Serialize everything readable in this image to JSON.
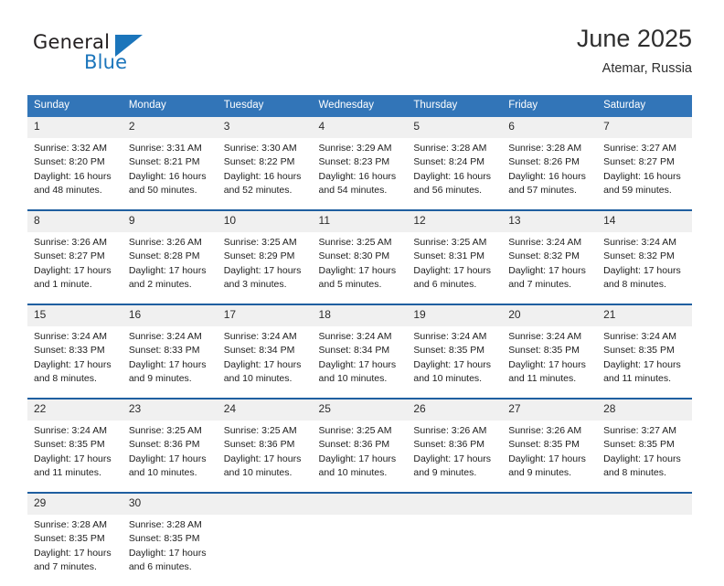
{
  "brand": {
    "name_part1": "General",
    "name_part2": "Blue",
    "flag_icon": "blue-triangle-flag-icon"
  },
  "header": {
    "title": "June 2025",
    "location": "Atemar, Russia"
  },
  "colors": {
    "header_blue": "#3275b8",
    "separator_blue": "#1f5fa0",
    "daynum_band": "#f0f0f0",
    "brand_blue": "#1b75bb"
  },
  "calendar": {
    "weekday_headers": [
      "Sunday",
      "Monday",
      "Tuesday",
      "Wednesday",
      "Thursday",
      "Friday",
      "Saturday"
    ],
    "weeks": [
      {
        "days": [
          {
            "num": "1",
            "sunrise": "Sunrise: 3:32 AM",
            "sunset": "Sunset: 8:20 PM",
            "daylight1": "Daylight: 16 hours",
            "daylight2": "and 48 minutes."
          },
          {
            "num": "2",
            "sunrise": "Sunrise: 3:31 AM",
            "sunset": "Sunset: 8:21 PM",
            "daylight1": "Daylight: 16 hours",
            "daylight2": "and 50 minutes."
          },
          {
            "num": "3",
            "sunrise": "Sunrise: 3:30 AM",
            "sunset": "Sunset: 8:22 PM",
            "daylight1": "Daylight: 16 hours",
            "daylight2": "and 52 minutes."
          },
          {
            "num": "4",
            "sunrise": "Sunrise: 3:29 AM",
            "sunset": "Sunset: 8:23 PM",
            "daylight1": "Daylight: 16 hours",
            "daylight2": "and 54 minutes."
          },
          {
            "num": "5",
            "sunrise": "Sunrise: 3:28 AM",
            "sunset": "Sunset: 8:24 PM",
            "daylight1": "Daylight: 16 hours",
            "daylight2": "and 56 minutes."
          },
          {
            "num": "6",
            "sunrise": "Sunrise: 3:28 AM",
            "sunset": "Sunset: 8:26 PM",
            "daylight1": "Daylight: 16 hours",
            "daylight2": "and 57 minutes."
          },
          {
            "num": "7",
            "sunrise": "Sunrise: 3:27 AM",
            "sunset": "Sunset: 8:27 PM",
            "daylight1": "Daylight: 16 hours",
            "daylight2": "and 59 minutes."
          }
        ]
      },
      {
        "days": [
          {
            "num": "8",
            "sunrise": "Sunrise: 3:26 AM",
            "sunset": "Sunset: 8:27 PM",
            "daylight1": "Daylight: 17 hours",
            "daylight2": "and 1 minute."
          },
          {
            "num": "9",
            "sunrise": "Sunrise: 3:26 AM",
            "sunset": "Sunset: 8:28 PM",
            "daylight1": "Daylight: 17 hours",
            "daylight2": "and 2 minutes."
          },
          {
            "num": "10",
            "sunrise": "Sunrise: 3:25 AM",
            "sunset": "Sunset: 8:29 PM",
            "daylight1": "Daylight: 17 hours",
            "daylight2": "and 3 minutes."
          },
          {
            "num": "11",
            "sunrise": "Sunrise: 3:25 AM",
            "sunset": "Sunset: 8:30 PM",
            "daylight1": "Daylight: 17 hours",
            "daylight2": "and 5 minutes."
          },
          {
            "num": "12",
            "sunrise": "Sunrise: 3:25 AM",
            "sunset": "Sunset: 8:31 PM",
            "daylight1": "Daylight: 17 hours",
            "daylight2": "and 6 minutes."
          },
          {
            "num": "13",
            "sunrise": "Sunrise: 3:24 AM",
            "sunset": "Sunset: 8:32 PM",
            "daylight1": "Daylight: 17 hours",
            "daylight2": "and 7 minutes."
          },
          {
            "num": "14",
            "sunrise": "Sunrise: 3:24 AM",
            "sunset": "Sunset: 8:32 PM",
            "daylight1": "Daylight: 17 hours",
            "daylight2": "and 8 minutes."
          }
        ]
      },
      {
        "days": [
          {
            "num": "15",
            "sunrise": "Sunrise: 3:24 AM",
            "sunset": "Sunset: 8:33 PM",
            "daylight1": "Daylight: 17 hours",
            "daylight2": "and 8 minutes."
          },
          {
            "num": "16",
            "sunrise": "Sunrise: 3:24 AM",
            "sunset": "Sunset: 8:33 PM",
            "daylight1": "Daylight: 17 hours",
            "daylight2": "and 9 minutes."
          },
          {
            "num": "17",
            "sunrise": "Sunrise: 3:24 AM",
            "sunset": "Sunset: 8:34 PM",
            "daylight1": "Daylight: 17 hours",
            "daylight2": "and 10 minutes."
          },
          {
            "num": "18",
            "sunrise": "Sunrise: 3:24 AM",
            "sunset": "Sunset: 8:34 PM",
            "daylight1": "Daylight: 17 hours",
            "daylight2": "and 10 minutes."
          },
          {
            "num": "19",
            "sunrise": "Sunrise: 3:24 AM",
            "sunset": "Sunset: 8:35 PM",
            "daylight1": "Daylight: 17 hours",
            "daylight2": "and 10 minutes."
          },
          {
            "num": "20",
            "sunrise": "Sunrise: 3:24 AM",
            "sunset": "Sunset: 8:35 PM",
            "daylight1": "Daylight: 17 hours",
            "daylight2": "and 11 minutes."
          },
          {
            "num": "21",
            "sunrise": "Sunrise: 3:24 AM",
            "sunset": "Sunset: 8:35 PM",
            "daylight1": "Daylight: 17 hours",
            "daylight2": "and 11 minutes."
          }
        ]
      },
      {
        "days": [
          {
            "num": "22",
            "sunrise": "Sunrise: 3:24 AM",
            "sunset": "Sunset: 8:35 PM",
            "daylight1": "Daylight: 17 hours",
            "daylight2": "and 11 minutes."
          },
          {
            "num": "23",
            "sunrise": "Sunrise: 3:25 AM",
            "sunset": "Sunset: 8:36 PM",
            "daylight1": "Daylight: 17 hours",
            "daylight2": "and 10 minutes."
          },
          {
            "num": "24",
            "sunrise": "Sunrise: 3:25 AM",
            "sunset": "Sunset: 8:36 PM",
            "daylight1": "Daylight: 17 hours",
            "daylight2": "and 10 minutes."
          },
          {
            "num": "25",
            "sunrise": "Sunrise: 3:25 AM",
            "sunset": "Sunset: 8:36 PM",
            "daylight1": "Daylight: 17 hours",
            "daylight2": "and 10 minutes."
          },
          {
            "num": "26",
            "sunrise": "Sunrise: 3:26 AM",
            "sunset": "Sunset: 8:36 PM",
            "daylight1": "Daylight: 17 hours",
            "daylight2": "and 9 minutes."
          },
          {
            "num": "27",
            "sunrise": "Sunrise: 3:26 AM",
            "sunset": "Sunset: 8:35 PM",
            "daylight1": "Daylight: 17 hours",
            "daylight2": "and 9 minutes."
          },
          {
            "num": "28",
            "sunrise": "Sunrise: 3:27 AM",
            "sunset": "Sunset: 8:35 PM",
            "daylight1": "Daylight: 17 hours",
            "daylight2": "and 8 minutes."
          }
        ]
      },
      {
        "days": [
          {
            "num": "29",
            "sunrise": "Sunrise: 3:28 AM",
            "sunset": "Sunset: 8:35 PM",
            "daylight1": "Daylight: 17 hours",
            "daylight2": "and 7 minutes."
          },
          {
            "num": "30",
            "sunrise": "Sunrise: 3:28 AM",
            "sunset": "Sunset: 8:35 PM",
            "daylight1": "Daylight: 17 hours",
            "daylight2": "and 6 minutes."
          },
          {
            "num": "",
            "sunrise": "",
            "sunset": "",
            "daylight1": "",
            "daylight2": ""
          },
          {
            "num": "",
            "sunrise": "",
            "sunset": "",
            "daylight1": "",
            "daylight2": ""
          },
          {
            "num": "",
            "sunrise": "",
            "sunset": "",
            "daylight1": "",
            "daylight2": ""
          },
          {
            "num": "",
            "sunrise": "",
            "sunset": "",
            "daylight1": "",
            "daylight2": ""
          },
          {
            "num": "",
            "sunrise": "",
            "sunset": "",
            "daylight1": "",
            "daylight2": ""
          }
        ]
      }
    ]
  }
}
